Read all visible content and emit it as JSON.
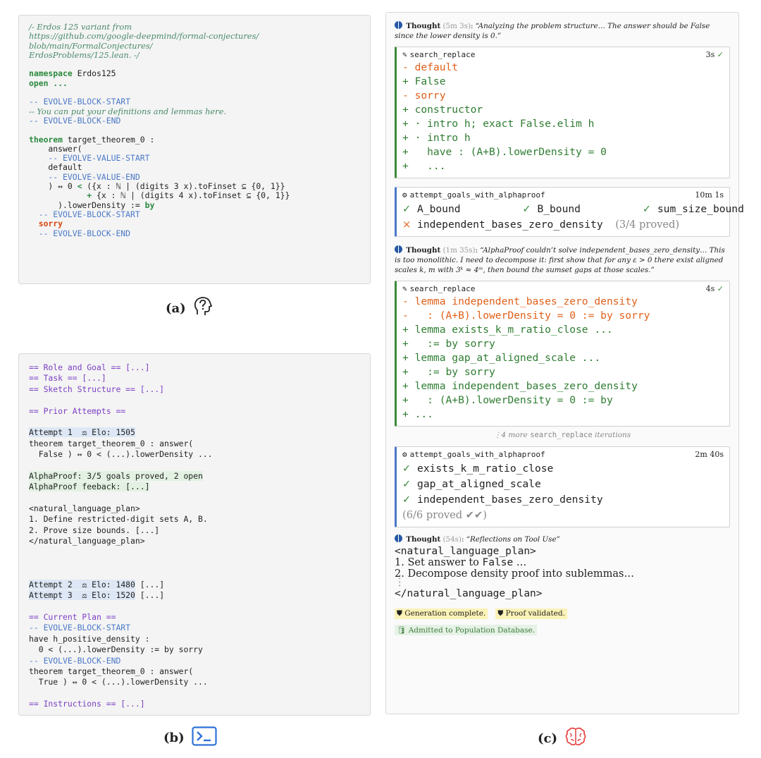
{
  "panel_a": {
    "lines": [
      "/- Erdos 125 variant from",
      "https://github.com/google-deepmind/formal-conjectures/",
      "blob/main/FormalConjectures/",
      "ErdosProblems/125.lean. -/",
      "",
      "namespace Erdos125",
      "open ...",
      "",
      "-- EVOLVE-BLOCK-START",
      "-- You can put your definitions and lemmas here.",
      "-- EVOLVE-BLOCK-END",
      "",
      "theorem target_theorem_0 :",
      "    answer(",
      "    -- EVOLVE-VALUE-START",
      "    default",
      "    -- EVOLVE-VALUE-END",
      "    ) ↔ 0 < ({x : ℕ | (digits 3 x).toFinset ⊆ {0, 1}}",
      "            + {x : ℕ | (digits 4 x).toFinset ⊆ {0, 1}}",
      "      ).lowerDensity := by",
      "  -- EVOLVE-BLOCK-START",
      "  sorry",
      "  -- EVOLVE-BLOCK-END"
    ],
    "caption": "(a)"
  },
  "panel_b": {
    "l1": "== Role and Goal == [...]",
    "l2": "== Task == [...]",
    "l3": "== Sketch Structure == [...]",
    "prior": "== Prior Attempts ==",
    "att1_label": "Attempt 1",
    "att1_elo": "Elo: 1505",
    "att1_l2": "theorem target_theorem_0 : answer(",
    "att1_l3": "  False ) ↔ 0 < (...).lowerDensity ...",
    "ap1": "AlphaProof: 3/5 goals proved, 2 open",
    "ap2": "AlphaProof feeback: [...]",
    "nl1": "<natural_language_plan>",
    "nl2": "1. Define restricted-digit sets A, B.",
    "nl3": "2. Prove size bounds. [...]",
    "nl4": "</natural_language_plan>",
    "att2_label": "Attempt 2",
    "att2_elo": "Elo: 1480",
    "att2_rest": " [...]",
    "att3_label": "Attempt 3",
    "att3_elo": "Elo: 1520",
    "att3_rest": " [...]",
    "cur": "== Current Plan ==",
    "ev1": "-- EVOLVE-BLOCK-START",
    "cp1": "have h_positive_density :",
    "cp2": "  0 < (...).lowerDensity := by sorry",
    "ev2": "-- EVOLVE-BLOCK-END",
    "cp3": "theorem target_theorem_0 : answer(",
    "cp4": "  True ) ↔ 0 < (...).lowerDensity ...",
    "instr": "== Instructions == [...]",
    "caption": "(b)"
  },
  "panel_c": {
    "thought_label": "Thought",
    "t1_time": "(5m 3s)",
    "t1_text": "“Analyzing the problem structure… The answer should be False since the lower density is 0.”",
    "sr1": {
      "name": "search_replace",
      "time": "3s",
      "lines": [
        {
          "sign": "-",
          "text": " default"
        },
        {
          "sign": "+",
          "text": " False"
        },
        {
          "sign": "-",
          "text": " sorry"
        },
        {
          "sign": "+",
          "text": " constructor"
        },
        {
          "sign": "+",
          "text": " · intro h; exact False.elim h"
        },
        {
          "sign": "+",
          "text": " · intro h"
        },
        {
          "sign": "+",
          "text": "   have : (A+B).lowerDensity = 0"
        },
        {
          "sign": "+",
          "text": "   ..."
        }
      ]
    },
    "ag1": {
      "name": "attempt_goals_with_alphaproof",
      "time": "10m 1s",
      "g1": "A_bound",
      "g2": "B_bound",
      "g3": "sum_size_bound",
      "g4": "independent_bases_zero_density",
      "g4_note": "(3/4 proved)"
    },
    "t2_time": "(1m 35s)",
    "t2_text": "“AlphaProof couldn’t solve independent_bases_zero_density… This is too monolithic. I need to decompose it: first show that for any ε > 0 there exist aligned scales k, m with 3ᵏ ≈ 4ᵐ, then bound the sumset gaps at those scales.”",
    "sr2": {
      "name": "search_replace",
      "time": "4s",
      "lines": [
        {
          "sign": "-",
          "text": " lemma independent_bases_zero_density"
        },
        {
          "sign": "-",
          "text": "   : (A+B).lowerDensity = 0 := by sorry"
        },
        {
          "sign": "+",
          "text": " lemma exists_k_m_ratio_close ..."
        },
        {
          "sign": "+",
          "text": "   := by sorry"
        },
        {
          "sign": "+",
          "text": " lemma gap_at_aligned_scale ..."
        },
        {
          "sign": "+",
          "text": "   := by sorry"
        },
        {
          "sign": "+",
          "text": " lemma independent_bases_zero_density"
        },
        {
          "sign": "+",
          "text": "   : (A+B).lowerDensity = 0 := by"
        },
        {
          "sign": "+",
          "text": " ..."
        }
      ]
    },
    "more_pre": "4 more",
    "more_code": "search_replace",
    "more_post": "iterations",
    "ag2": {
      "name": "attempt_goals_with_alphaproof",
      "time": "2m 40s",
      "g1": "exists_k_m_ratio_close",
      "g2": "gap_at_aligned_scale",
      "g3": "independent_bases_zero_density",
      "summary": "(6/6 proved",
      "summary_end": ")"
    },
    "t3_time": "(54s)",
    "t3_text": "“Reflections on Tool Use”",
    "plan_open": "<natural_language_plan>",
    "plan_1a": "1. Set answer to ",
    "plan_1b": "False",
    "plan_1c": " …",
    "plan_2": "2. Decompose density proof into sublemmas…",
    "plan_close": "</natural_language_plan>",
    "badge1": "Generation complete.",
    "badge2": "Proof validated.",
    "badge3": "Admitted to Population Database.",
    "caption": "(c)"
  }
}
